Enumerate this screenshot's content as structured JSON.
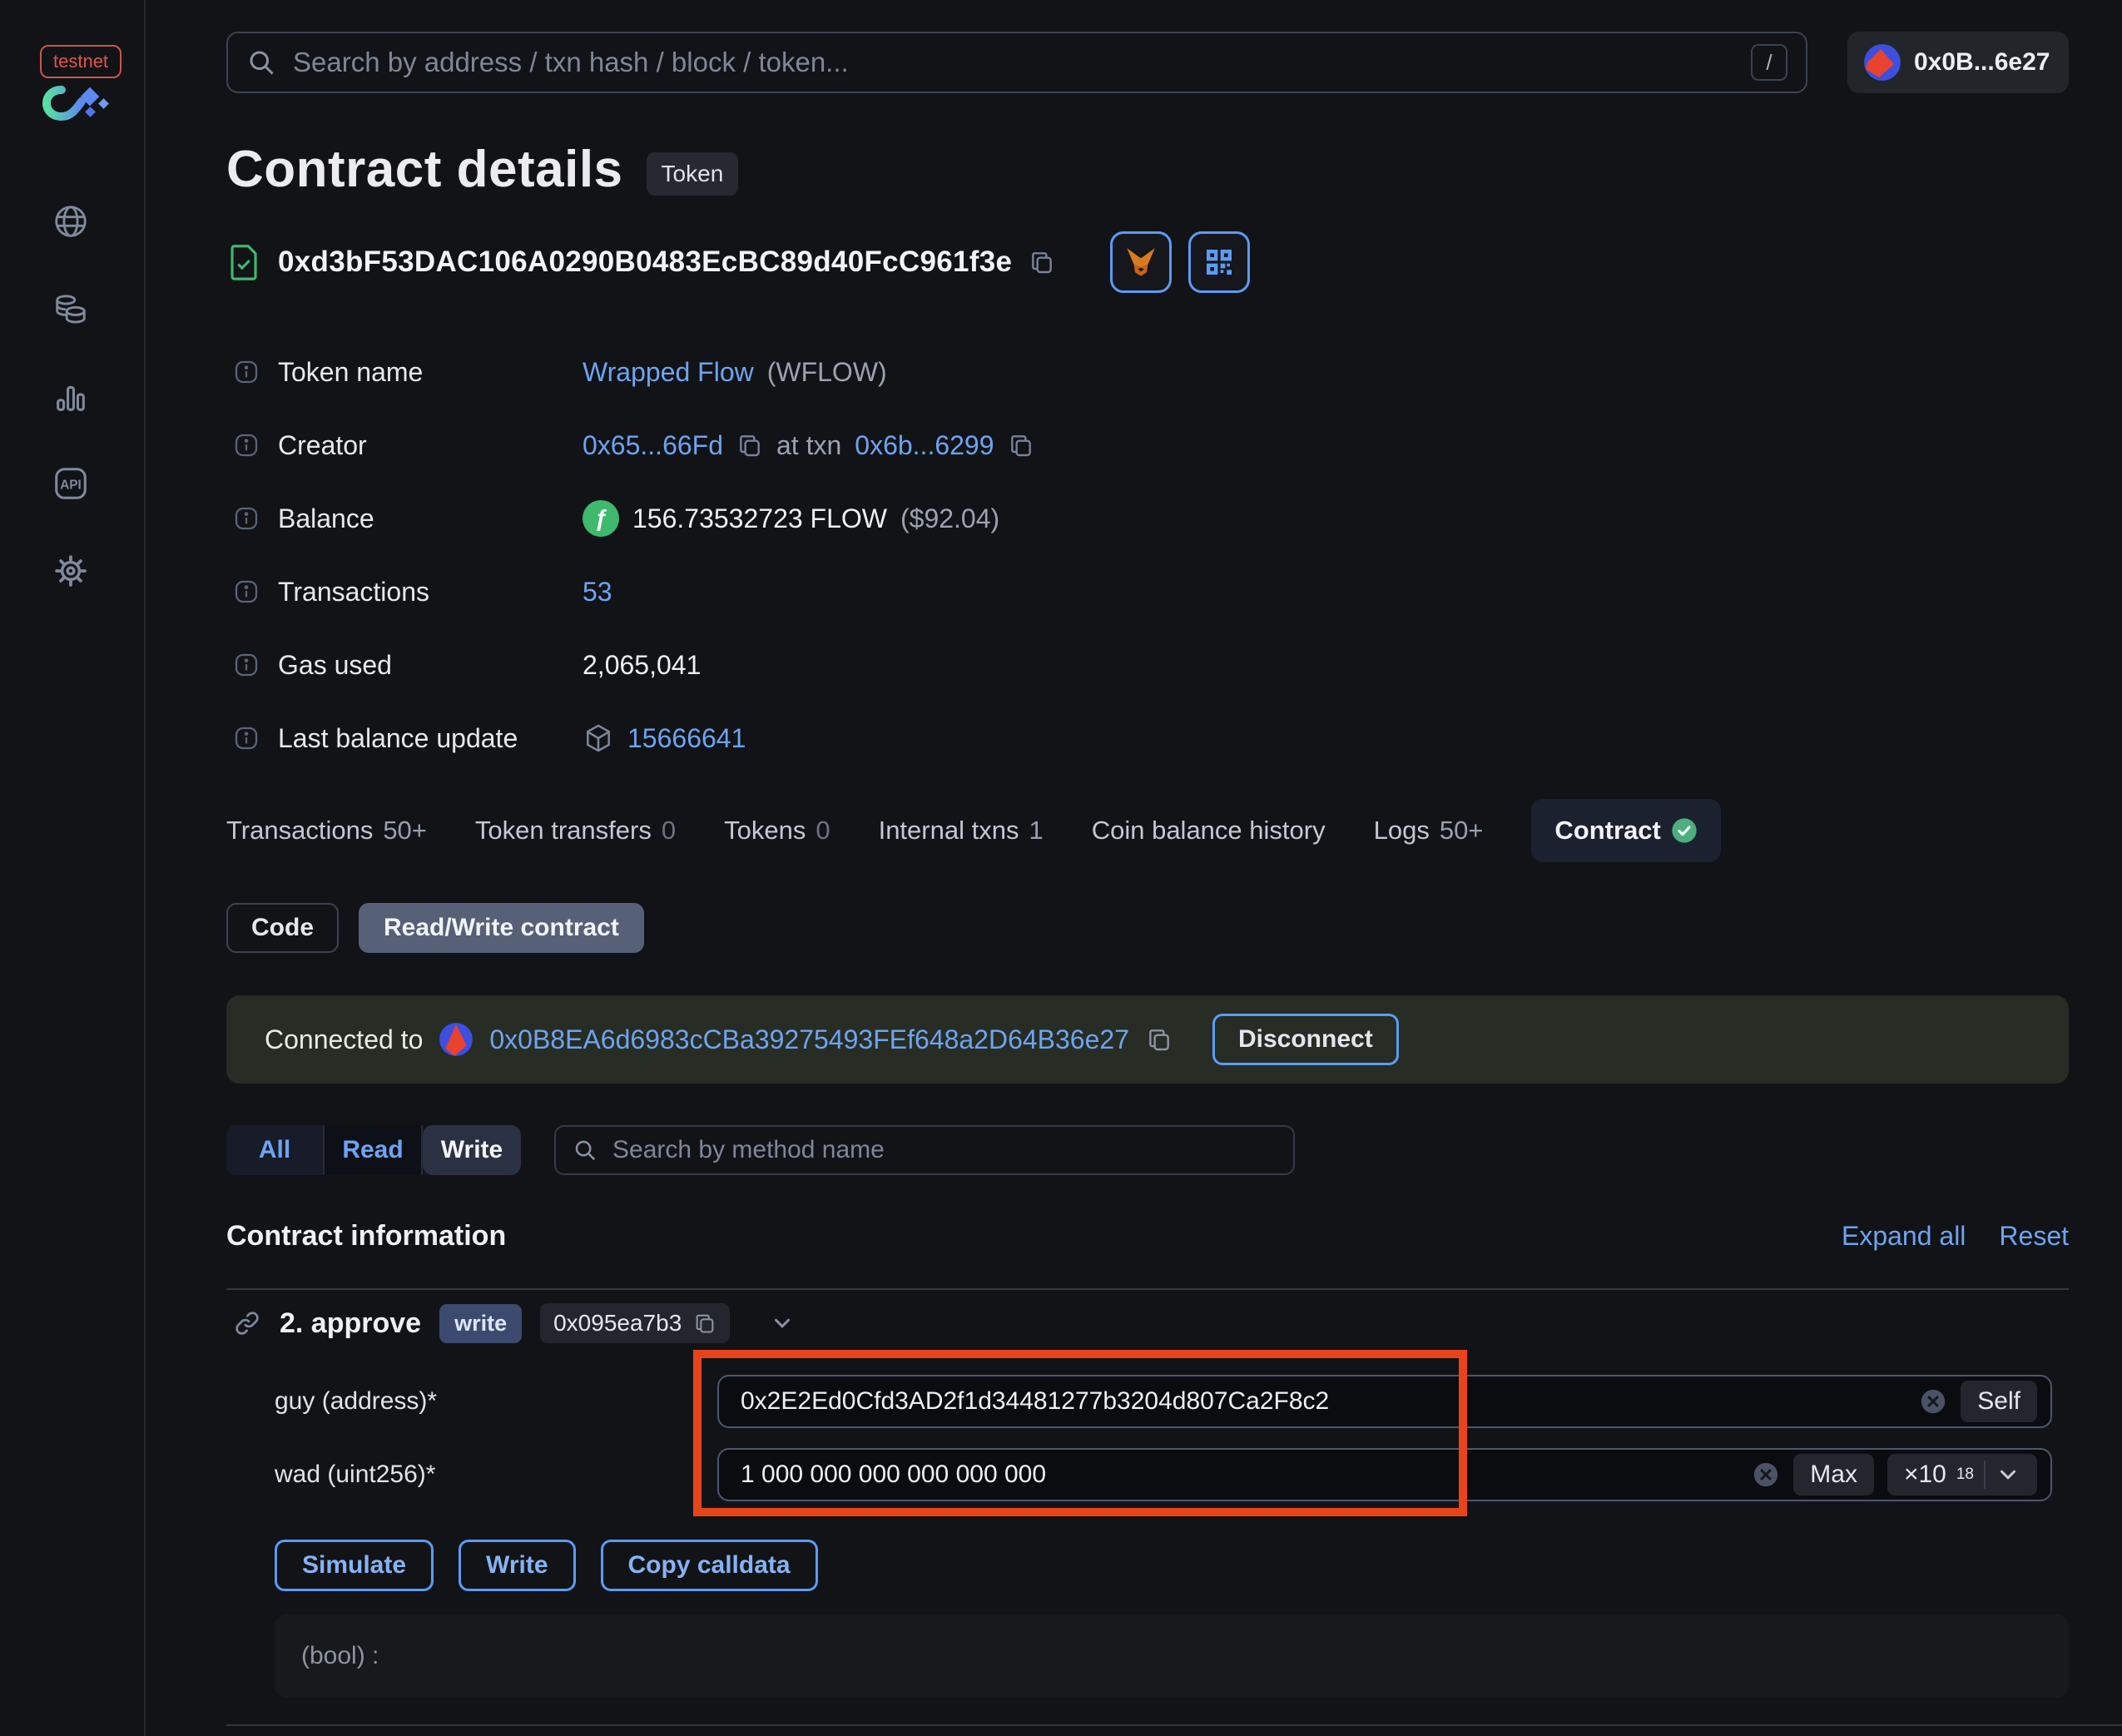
{
  "sidebar": {
    "env_badge": "testnet"
  },
  "topbar": {
    "search_placeholder": "Search by address / txn hash / block / token...",
    "shortcut": "/",
    "wallet": "0x0B...6e27"
  },
  "page": {
    "title": "Contract details",
    "type_badge": "Token",
    "address": "0xd3bF53DAC106A0290B0483EcBC89d40FcC961f3e"
  },
  "details": {
    "token_name": {
      "label": "Token name",
      "link": "Wrapped Flow",
      "suffix": "(WFLOW)"
    },
    "creator": {
      "label": "Creator",
      "address": "0x65...66Fd",
      "mid": "at txn",
      "txn": "0x6b...6299"
    },
    "balance": {
      "label": "Balance",
      "value": "156.73532723 FLOW",
      "usd": "($92.04)"
    },
    "transactions": {
      "label": "Transactions",
      "value": "53"
    },
    "gas_used": {
      "label": "Gas used",
      "value": "2,065,041"
    },
    "last_balance_update": {
      "label": "Last balance update",
      "value": "15666641"
    }
  },
  "tabs": [
    {
      "label": "Transactions",
      "count": "50+"
    },
    {
      "label": "Token transfers",
      "count": "0"
    },
    {
      "label": "Tokens",
      "count": "0"
    },
    {
      "label": "Internal txns",
      "count": "1"
    },
    {
      "label": "Coin balance history"
    },
    {
      "label": "Logs",
      "count": "50+"
    },
    {
      "label": "Contract",
      "active": true
    }
  ],
  "subtabs": {
    "code": "Code",
    "read_write": "Read/Write contract"
  },
  "connection": {
    "prefix": "Connected to",
    "address": "0x0B8EA6d6983cCBa39275493FEf648a2D64B36e27",
    "disconnect": "Disconnect"
  },
  "filter": {
    "all": "All",
    "read": "Read",
    "write": "Write",
    "search_placeholder": "Search by method name"
  },
  "section": {
    "title": "Contract information",
    "expand_all": "Expand all",
    "reset": "Reset"
  },
  "method": {
    "name": "2. approve",
    "badge": "write",
    "selector": "0x095ea7b3",
    "fields": [
      {
        "label": "guy (address)*",
        "value": "0x2E2Ed0Cfd3AD2f1d34481277b3204d807Ca2F8c2",
        "action": "Self"
      },
      {
        "label": "wad (uint256)*",
        "value": "1 000 000 000 000 000 000",
        "action": "Max",
        "multiplier": "×10",
        "exponent": "18"
      }
    ],
    "buttons": {
      "simulate": "Simulate",
      "write": "Write",
      "copy_calldata": "Copy calldata"
    },
    "output": "(bool) :"
  },
  "colors": {
    "accent_blue": "#5c9bf5",
    "annotation_red": "#e8441c",
    "success_green": "#3eb96e"
  }
}
